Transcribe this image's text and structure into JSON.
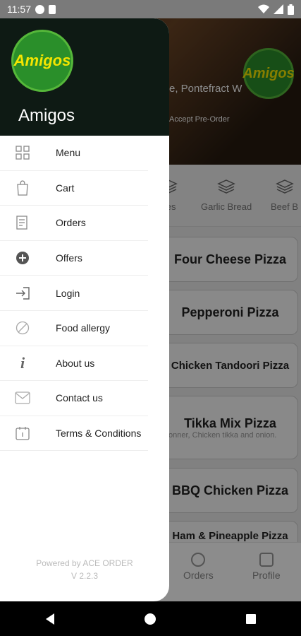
{
  "status": {
    "time": "11:57"
  },
  "hero": {
    "address": "e, Pontefract W",
    "preorder": "Accept Pre-Order",
    "logo_text": "Amigos"
  },
  "categories": [
    {
      "label": "nes"
    },
    {
      "label": "Garlic Bread"
    },
    {
      "label": "Beef B"
    }
  ],
  "pizzas": [
    {
      "name": "Four Cheese Pizza",
      "desc": ""
    },
    {
      "name": "Pepperoni Pizza",
      "desc": ""
    },
    {
      "name": "Chicken Tandoori Pizza",
      "desc": ""
    },
    {
      "name": "Tikka Mix Pizza",
      "desc": "onner, Chicken tikka and onion."
    },
    {
      "name": "BBQ Chicken Pizza",
      "desc": ""
    },
    {
      "name": "Ham & Pineapple Pizza",
      "desc": ""
    }
  ],
  "bottom_nav": [
    {
      "label": "Orders",
      "icon": "orders-icon"
    },
    {
      "label": "Profile",
      "icon": "profile-icon"
    }
  ],
  "drawer": {
    "logo_text": "Amigos",
    "name": "Amigos",
    "items": [
      {
        "label": "Menu",
        "icon": "grid-icon"
      },
      {
        "label": "Cart",
        "icon": "cart-icon"
      },
      {
        "label": "Orders",
        "icon": "orders-icon"
      },
      {
        "label": "Offers",
        "icon": "offers-icon"
      },
      {
        "label": "Login",
        "icon": "login-icon"
      },
      {
        "label": "Food allergy",
        "icon": "allergy-icon"
      },
      {
        "label": "About us",
        "icon": "info-icon"
      },
      {
        "label": "Contact us",
        "icon": "contact-icon"
      },
      {
        "label": "Terms & Conditions",
        "icon": "terms-icon"
      }
    ],
    "powered_by": "Powered by ACE ORDER",
    "version": "V 2.2.3"
  },
  "colors": {
    "drawer_header": "#0e1a14",
    "logo_green": "#2a8f2a",
    "logo_text": "#f4e500"
  }
}
